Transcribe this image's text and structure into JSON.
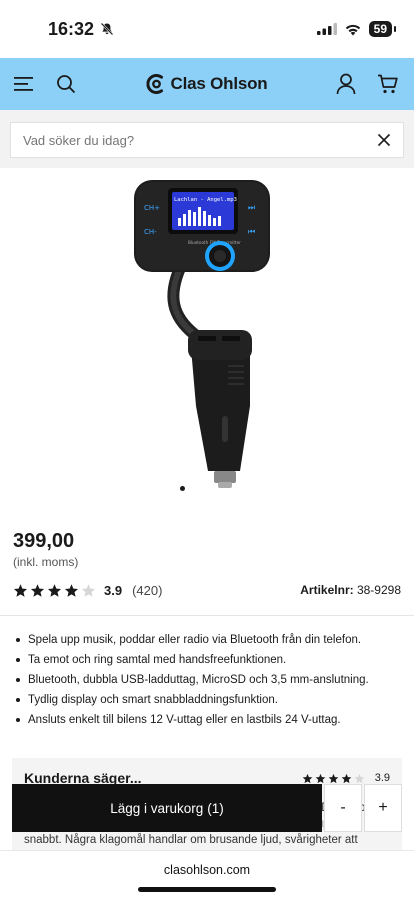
{
  "status": {
    "time": "16:32",
    "battery": "59"
  },
  "header": {
    "brand": "Clas Ohlson"
  },
  "search": {
    "placeholder": "Vad söker du idag?"
  },
  "product": {
    "price": "399,00",
    "vat_note": "(inkl. moms)",
    "rating_value": "3.9",
    "rating_count": "(420)",
    "rating_stars": 3.9,
    "article_label": "Artikelnr:",
    "article_number": "38-9298",
    "bullets": [
      "Spela upp musik, poddar eller radio via Bluetooth från din telefon.",
      "Ta emot och ring samtal med handsfreefunktionen.",
      "Bluetooth, dubbla USB-ladduttag, MicroSD och 3,5 mm-anslutning.",
      "Tydlig display och smart snabbladdningsfunktion.",
      "Ansluts enkelt till bilens 12 V-uttag eller en lastbils 24 V-uttag."
    ]
  },
  "reviews": {
    "title": "Kunderna säger...",
    "rating_value": "3.9",
    "text": "Många tycker att produkten är riktigt bra och fungerar bra. Den är också positiv respons på att den är prisvärd och att den kopplar upp sig snabbt. Några klagomål handlar om brusande ljud, svårigheter att"
  },
  "cart": {
    "add_label": "Lägg i varukorg",
    "count": "(1)",
    "minus": "-",
    "plus": "+"
  },
  "browser": {
    "url": "clasohlson.com"
  },
  "device_screen": {
    "line1": "Lachlan - Angel.mp3",
    "brand": "Bluetooth FM Transmitter"
  },
  "colors": {
    "header_bg": "#8dd0f7",
    "accent_ring": "#1fa5ff"
  }
}
